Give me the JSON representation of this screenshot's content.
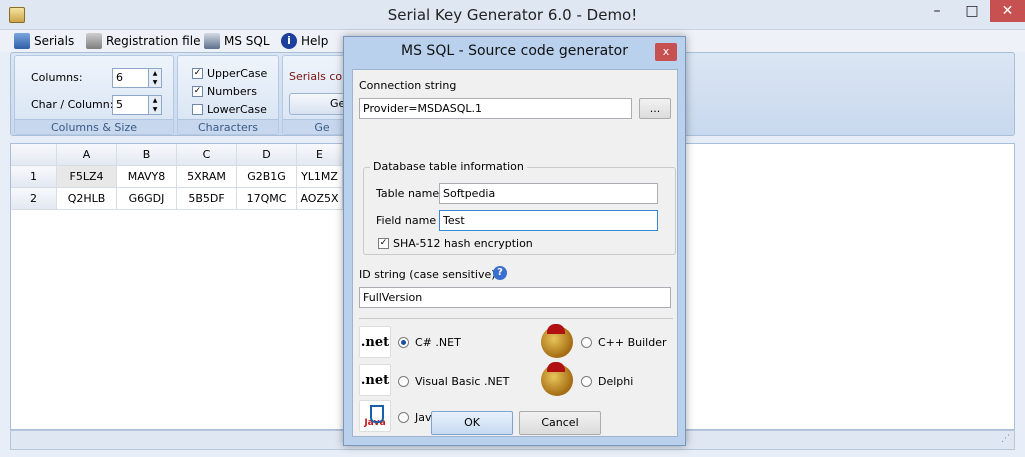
{
  "window": {
    "title": "Serial Key Generator 6.0 - Demo!",
    "minimize": "–",
    "maximize": "□",
    "close": "✕"
  },
  "menu": [
    {
      "label": "Serials",
      "icon": "serials-icon"
    },
    {
      "label": "Registration file",
      "icon": "registration-icon"
    },
    {
      "label": "MS SQL",
      "icon": "database-icon"
    },
    {
      "label": "Help",
      "icon": "info-icon"
    }
  ],
  "ribbon": {
    "columns_size": {
      "group_label": "Columns & Size",
      "columns_label": "Columns:",
      "columns_value": "6",
      "char_label": "Char / Column:",
      "char_value": "5"
    },
    "characters": {
      "group_label": "Characters",
      "options": [
        {
          "label": "UpperCase",
          "checked": true
        },
        {
          "label": "Numbers",
          "checked": true
        },
        {
          "label": "LowerCase",
          "checked": false
        }
      ]
    },
    "generate": {
      "serials_count_label": "Serials cour",
      "button_label": "Ge",
      "group_label": "Ge"
    }
  },
  "grid": {
    "columns": [
      "A",
      "B",
      "C",
      "D",
      "E"
    ],
    "rows": [
      {
        "num": "1",
        "cells": [
          "F5LZ4",
          "MAVY8",
          "5XRAM",
          "G2B1G",
          "YL1MZ"
        ]
      },
      {
        "num": "2",
        "cells": [
          "Q2HLB",
          "G6GDJ",
          "5B5DF",
          "17QMC",
          "AOZ5X"
        ]
      }
    ]
  },
  "dialog": {
    "title": "MS SQL - Source code generator",
    "close": "x",
    "connection_label": "Connection string",
    "connection_value": "Provider=MSDASQL.1",
    "browse_label": "...",
    "db_info_label": "Database table information",
    "table_label": "Table name",
    "table_value": "Softpedia",
    "field_label": "Field name",
    "field_value": "Test",
    "sha_label": "SHA-512 hash encryption",
    "sha_checked": true,
    "id_label": "ID string (case sensitive)",
    "id_value": "FullVersion",
    "languages": [
      {
        "label": "C# .NET",
        "selected": true,
        "logo": ".net"
      },
      {
        "label": "C++ Builder",
        "selected": false,
        "logo": "builder-helmet"
      },
      {
        "label": "Visual Basic .NET",
        "selected": false,
        "logo": ".net"
      },
      {
        "label": "Delphi",
        "selected": false,
        "logo": "delphi-helmet"
      },
      {
        "label": "Java",
        "selected": false,
        "logo": "java"
      }
    ],
    "logo_net_text": ".net",
    "logo_java_text": "Java",
    "ok_label": "OK",
    "cancel_label": "Cancel"
  }
}
